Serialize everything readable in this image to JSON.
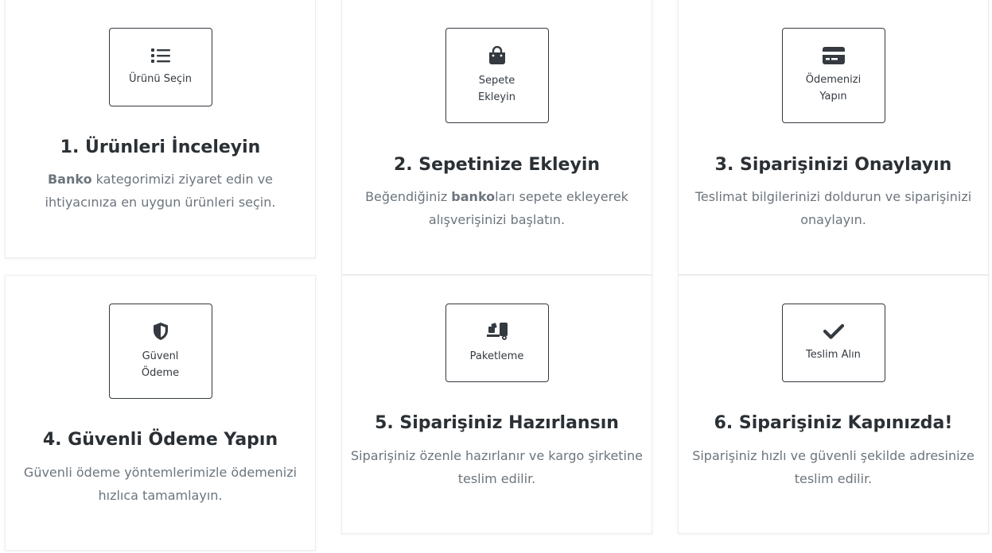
{
  "steps": [
    {
      "icon": "list-icon",
      "icon_label": "Ürünü Seçin",
      "title": "1. Ürünleri İnceleyin",
      "desc_strong": "Banko",
      "desc_rest": " kategorimizi ziyaret edin ve ihtiyacınıza en uygun ürünleri seçin."
    },
    {
      "icon": "shopping-bag-icon",
      "icon_label": "Sepete\nEkleyin",
      "title": "2. Sepetinize Ekleyin",
      "desc_pre": "Beğendiğiniz ",
      "desc_strong": "banko",
      "desc_rest": "ları sepete ekleyerek alışverişinizi başlatın."
    },
    {
      "icon": "credit-card-icon",
      "icon_label": "Ödemenizi\nYapın",
      "title": "3. Siparişinizi Onaylayın",
      "desc_rest": "Teslimat bilgilerinizi doldurun ve siparişinizi onaylayın."
    },
    {
      "icon": "shield-icon",
      "icon_label": "Güvenl\nÖdeme",
      "title": "4. Güvenli Ödeme Yapın",
      "desc_rest": "Güvenli ödeme yöntemlerimizle ödemenizi hızlıca tamamlayın."
    },
    {
      "icon": "packaging-dolly-icon",
      "icon_label": "Paketleme",
      "title": "5. Siparişiniz Hazırlansın",
      "desc_rest": "Siparişiniz özenle hazırlanır ve kargo şirketine teslim edilir."
    },
    {
      "icon": "checkmark-icon",
      "icon_label": "Teslim Alın",
      "title": "6. Siparişiniz Kapınızda!",
      "desc_rest": "Siparişiniz hızlı ve güvenli şekilde adresinize teslim edilir."
    }
  ]
}
